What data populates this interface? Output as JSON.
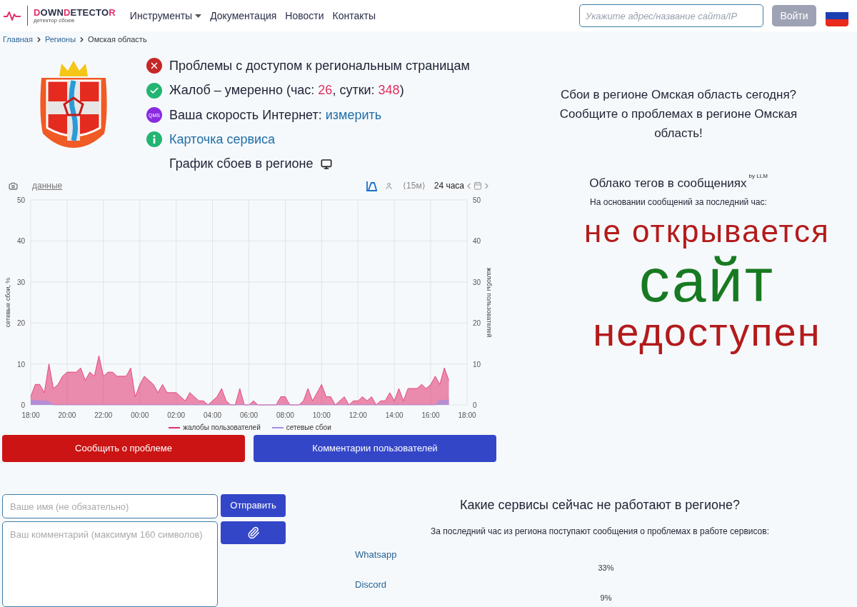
{
  "header": {
    "logo": {
      "parts": [
        {
          "text": "D",
          "accent": true
        },
        {
          "text": "OWN",
          "accent": false
        },
        {
          "text": "D",
          "accent": true
        },
        {
          "text": "ETECTO",
          "accent": false
        },
        {
          "text": "R",
          "accent": true
        }
      ],
      "tagline": "детектор сбоев"
    },
    "nav": [
      {
        "label": "Инструменты",
        "dropdown": true
      },
      {
        "label": "Документация",
        "dropdown": false
      },
      {
        "label": "Новости",
        "dropdown": false
      },
      {
        "label": "Контакты",
        "dropdown": false
      }
    ],
    "search": {
      "placeholder": "Укажите адрес/название сайта/IP"
    },
    "login_button": "Войти"
  },
  "breadcrumbs": [
    {
      "label": "Главная",
      "current": false
    },
    {
      "label": "Регионы",
      "current": false
    },
    {
      "label": "Омская область",
      "current": true
    }
  ],
  "status": [
    {
      "kind": "error",
      "parts": [
        {
          "kind": "text",
          "text": "Проблемы с доступом к региональным страницам"
        }
      ]
    },
    {
      "kind": "ok",
      "parts": [
        {
          "kind": "text",
          "text": "Жалоб – умеренно (час: "
        },
        {
          "kind": "number",
          "text": "26"
        },
        {
          "kind": "text",
          "text": ", сутки: "
        },
        {
          "kind": "number",
          "text": "348"
        },
        {
          "kind": "text",
          "text": ")"
        }
      ]
    },
    {
      "kind": "speed",
      "badge": "QMS",
      "parts": [
        {
          "kind": "text",
          "text": "Ваша скорость Интернет: "
        },
        {
          "kind": "link",
          "text": "измерить"
        }
      ]
    },
    {
      "kind": "info",
      "parts": [
        {
          "kind": "link",
          "text": "Карточка сервиса"
        }
      ]
    },
    {
      "kind": "chart",
      "parts": [
        {
          "kind": "text",
          "text": "График сбоев в регионе"
        }
      ]
    }
  ],
  "chart": {
    "toolbar": {
      "data_link": "данные",
      "interval": "⟨15м⟩",
      "period": "24 часа"
    },
    "right_axis": {
      "label": "жалобы пользователей",
      "ticks": [
        "50",
        "40",
        "30",
        "20",
        "10",
        "0"
      ]
    },
    "chart_data": {
      "type": "area",
      "grid": true,
      "legend": "bottom",
      "ylabel": "сетевые сбои, %",
      "ylim": [
        0,
        50
      ],
      "yticks": [
        0,
        10,
        20,
        30,
        40,
        50
      ],
      "categories": [
        "18:00",
        null,
        null,
        null,
        null,
        null,
        null,
        null,
        "20:00",
        null,
        null,
        null,
        null,
        null,
        null,
        null,
        "22:00",
        null,
        null,
        null,
        null,
        null,
        null,
        null,
        "00:00",
        null,
        null,
        null,
        null,
        null,
        null,
        null,
        "02:00",
        null,
        null,
        null,
        null,
        null,
        null,
        null,
        "04:00",
        null,
        null,
        null,
        null,
        null,
        null,
        null,
        "06:00",
        null,
        null,
        null,
        null,
        null,
        null,
        null,
        "08:00",
        null,
        null,
        null,
        null,
        null,
        null,
        null,
        "10:00",
        null,
        null,
        null,
        null,
        null,
        null,
        null,
        "12:00",
        null,
        null,
        null,
        null,
        null,
        null,
        null,
        "14:00",
        null,
        null,
        null,
        null,
        null,
        null,
        null,
        "16:00",
        null,
        null,
        null,
        null,
        null,
        null,
        null,
        "18:00"
      ],
      "series": [
        {
          "name": "жалобы пользователей",
          "color": "#e0306a",
          "values": [
            2,
            5,
            5,
            3,
            10,
            4,
            5,
            7,
            8,
            8,
            8,
            9,
            6,
            8,
            7,
            12,
            7,
            8,
            8,
            7,
            7,
            7,
            9,
            2,
            5,
            7,
            6,
            5,
            3,
            5,
            3,
            3,
            3,
            2,
            1,
            3,
            2,
            1,
            1,
            0,
            1,
            2,
            4,
            1,
            0,
            0,
            4,
            0,
            0,
            1,
            0,
            0,
            0,
            0,
            0,
            2,
            2,
            0,
            0,
            0,
            1,
            4,
            1,
            3,
            5,
            2,
            2,
            0,
            1,
            2,
            0,
            1,
            1,
            2,
            1,
            2,
            0,
            1,
            1,
            3,
            1,
            4,
            1,
            4,
            4,
            4,
            5,
            4,
            5,
            7,
            5,
            9,
            6,
            null,
            null,
            null,
            null
          ]
        },
        {
          "name": "сетевые сбои",
          "color": "#a98ee0",
          "values": [
            1.2,
            1.1,
            1,
            1,
            0.8,
            0,
            0,
            0,
            0,
            0,
            0,
            0,
            0,
            0,
            0,
            0,
            0,
            0,
            0,
            0,
            0,
            0,
            0,
            0,
            0,
            0,
            0,
            0,
            0,
            0,
            0,
            0,
            0,
            0,
            0,
            0,
            0,
            0,
            0,
            0,
            0,
            0,
            0,
            0,
            0,
            0,
            0,
            0,
            0,
            0,
            0,
            0,
            0,
            0,
            0,
            0,
            0,
            0,
            0,
            0,
            0,
            0,
            0,
            0,
            0,
            0,
            0,
            0,
            0,
            0,
            0,
            0,
            0,
            0,
            0,
            0,
            0,
            0,
            0,
            0,
            0,
            0,
            0,
            0,
            0,
            0,
            0,
            0,
            0,
            0,
            1.1,
            1.1,
            1.3,
            null,
            null,
            null,
            null
          ]
        }
      ]
    }
  },
  "actions": [
    {
      "kind": "report",
      "label": "Сообщить о проблеме"
    },
    {
      "kind": "comments",
      "label": "Комментарии пользователей"
    }
  ],
  "comment_form": {
    "name": {
      "placeholder": "Ваше имя (не обязательно)"
    },
    "send_button": "Отправить",
    "comment": {
      "placeholder": "Ваш комментарий (максимум 160 символов)"
    }
  },
  "region_prompt": {
    "title": "Сбои в регионе Омская область сегодня?",
    "text": "Сообщите о проблемах в регионе Омская область!"
  },
  "tag_cloud": {
    "title": "Облако тегов в сообщениях",
    "title_sup": "by LLM",
    "subtitle": "На основании сообщений за последний час:",
    "tags": [
      {
        "text": "не открывается",
        "color": "#b31b1b",
        "kind": "medium"
      },
      {
        "text": "сайт",
        "color": "#177a22",
        "kind": "large"
      },
      {
        "text": "недоступен",
        "color": "#b31b1b",
        "kind": "big"
      }
    ]
  },
  "services": {
    "title": "Какие сервисы сейчас не работают в регионе?",
    "subtitle": "За последний час из региона поступают сообщения о проблемах в работе сервисов:",
    "items": [
      {
        "name": "Whatsapp",
        "share": "33%"
      },
      {
        "name": "Discord",
        "share": "9%"
      }
    ]
  }
}
